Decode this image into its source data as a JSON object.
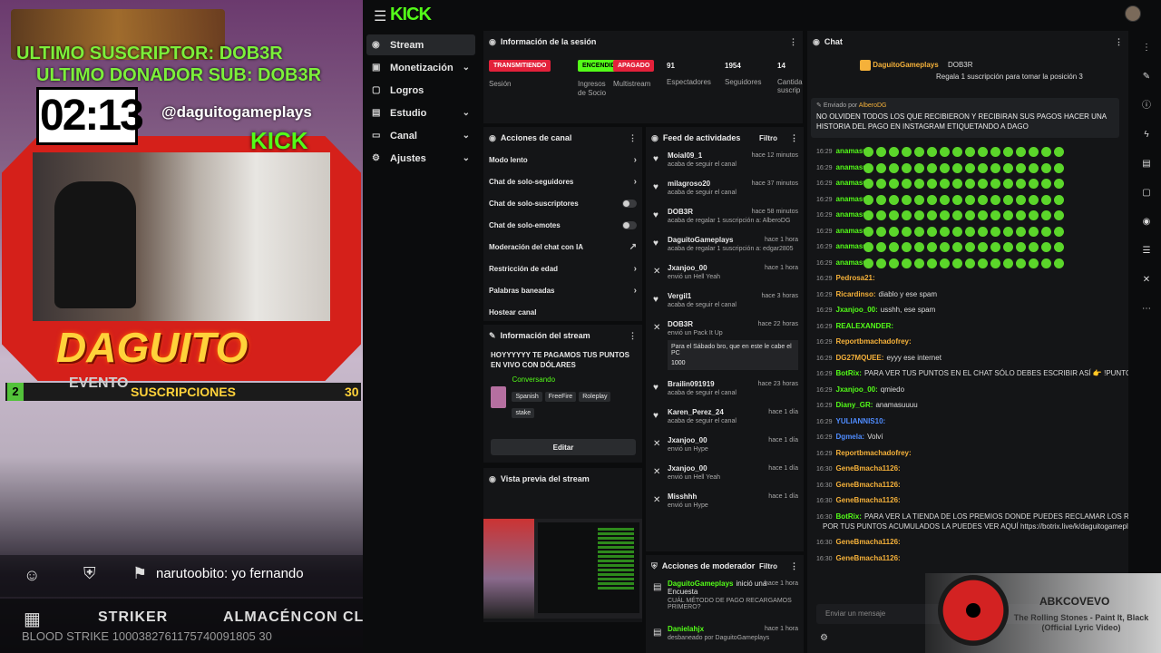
{
  "overlay": {
    "sub": "ULTIMO SUSCRIPTOR: DOB3R",
    "donor": "ULTIMO DONADOR SUB: DOB3R",
    "timer": "02:13",
    "instagram": "@daguitogameplays",
    "kick": "KICK",
    "name": "DAGUITO",
    "evento": "EVENTO",
    "bar_num": "2",
    "bar_label": "SUSCRIPCIONES",
    "bar_count": "30",
    "chatline": "narutoobito:  yo fernando",
    "menu": [
      "STRIKER",
      "ALMACÉN",
      "CON CLA"
    ],
    "code": "BLOOD STRIKE 1000382761175740091805 30"
  },
  "top": {
    "logo": "KICK"
  },
  "sidebar": [
    {
      "label": "Stream",
      "icon": "◉",
      "active": true
    },
    {
      "label": "Monetización",
      "icon": "▣",
      "chev": "⌄"
    },
    {
      "label": "Logros",
      "icon": "▢"
    },
    {
      "label": "Estudio",
      "icon": "▤",
      "chev": "⌄"
    },
    {
      "label": "Canal",
      "icon": "▭",
      "chev": "⌄"
    },
    {
      "label": "Ajustes",
      "icon": "⚙",
      "chev": "⌄"
    }
  ],
  "session": {
    "title": "Información de la sesión",
    "badges": [
      {
        "label": "TRANSMITIENDO",
        "color": "#e3213a"
      },
      {
        "label": "ENCENDIDO",
        "color": "#53fc18"
      },
      {
        "label": "APAGADO",
        "color": "#e3213a"
      }
    ],
    "badge_labels": [
      "Sesión",
      "Ingresos de Socio",
      "Multistream"
    ],
    "stats": [
      {
        "value": "91",
        "label": "Espectadores"
      },
      {
        "value": "1954",
        "label": "Seguidores"
      },
      {
        "value": "14",
        "label": "Cantidad suscrip"
      }
    ]
  },
  "canal": {
    "title": "Acciones de canal",
    "items": [
      "Modo lento",
      "Chat de solo-seguidores",
      "Chat de solo-suscriptores",
      "Chat de solo-emotes",
      "Moderación del chat con IA",
      "Restricción de edad",
      "Palabras baneadas",
      "Hostear canal"
    ]
  },
  "info": {
    "title": "Información del stream",
    "text": "HOYYYYYY TE PAGAMOS TUS PUNTOS EN VIVO CON DÓLARES",
    "category": "Conversando",
    "tags": [
      "Spanish",
      "FreeFire",
      "Roleplay",
      "stake"
    ],
    "edit": "Editar"
  },
  "preview": {
    "title": "Vista previa del stream"
  },
  "feed": {
    "title": "Feed de actividades",
    "filter": "Filtro",
    "items": [
      {
        "icon": "♥",
        "name": "Moial09_1",
        "time": "hace 12 minutos",
        "desc": "acaba de seguir el canal"
      },
      {
        "icon": "♥",
        "name": "milagroso20",
        "time": "hace 37 minutos",
        "desc": "acaba de seguir el canal"
      },
      {
        "icon": "♥",
        "name": "DOB3R",
        "time": "hace 58 minutos",
        "desc": "acaba de regalar 1 suscripción a: AlberoDG"
      },
      {
        "icon": "♥",
        "name": "DaguitoGameplays",
        "time": "hace 1 hora",
        "desc": "acaba de regalar 1 suscripción a: edgar2805"
      },
      {
        "icon": "✕",
        "name": "Jxanjoo_00",
        "time": "hace 1 hora",
        "desc": "envió un Hell Yeah"
      },
      {
        "icon": "♥",
        "name": "Vergil1",
        "time": "hace 3 horas",
        "desc": "acaba de seguir el canal"
      },
      {
        "icon": "✕",
        "name": "DOB3R",
        "time": "hace 22 horas",
        "desc": "envió un Pack It Up"
      },
      {
        "icon": "♥",
        "name": "Brailin091919",
        "time": "hace 23 horas",
        "desc": "acaba de seguir el canal"
      },
      {
        "icon": "♥",
        "name": "Karen_Perez_24",
        "time": "hace 1 día",
        "desc": "acaba de seguir el canal"
      },
      {
        "icon": "✕",
        "name": "Jxanjoo_00",
        "time": "hace 1 día",
        "desc": "envió un Hype"
      },
      {
        "icon": "✕",
        "name": "Jxanjoo_00",
        "time": "hace 1 día",
        "desc": "envió un Hell Yeah"
      },
      {
        "icon": "✕",
        "name": "Misshhh",
        "time": "hace 1 día",
        "desc": "envió un Hype"
      }
    ],
    "note": "Para el Sábado bro, que en este le cabe el PC",
    "note_amount": "1000"
  },
  "mod": {
    "title": "Acciones de moderador",
    "filter": "Filtro",
    "items": [
      {
        "name": "DaguitoGameplays",
        "action": "inició una Encuesta",
        "time": "hace 1 hora",
        "desc": "CUÁL MÉTODO DE PAGO RECARGAMOS PRIMERO?"
      },
      {
        "name": "Danielahjx",
        "action": "",
        "time": "hace 1 hora",
        "desc": "desbaneado por DaguitoGameplays"
      }
    ]
  },
  "chat": {
    "title": "Chat",
    "gift_user": "DaguitoGameplays",
    "gift_to": "DOB3R",
    "gift_text": "Regala 1 suscripción para tomar la posición 3",
    "pinned_by": "Enviado por",
    "pinned_user": "AlberoDG",
    "pinned_text": "NO OLVIDEN TODOS LOS QUE RECIBIERON Y RECIBIRAN SUS PAGOS HACER UNA HISTORIA DEL PAGO EN INSTAGRAM ETIQUETANDO A DAGO",
    "emote_lines": [
      {
        "t": "16:29",
        "u": "anamasu:"
      },
      {
        "t": "16:29",
        "u": "anamasu:"
      },
      {
        "t": "16:29",
        "u": "anamasu:"
      },
      {
        "t": "16:29",
        "u": "anamasu:"
      },
      {
        "t": "16:29",
        "u": "anamasu:"
      },
      {
        "t": "16:29",
        "u": "anamasu:"
      },
      {
        "t": "16:29",
        "u": "anamasu:"
      },
      {
        "t": "16:29",
        "u": "anamasu:"
      }
    ],
    "lines": [
      {
        "t": "16:29",
        "u": "Pedrosa21:",
        "m": "",
        "c": "#f5b13a"
      },
      {
        "t": "16:29",
        "u": "Ricardinso:",
        "m": "diablo y ese spam",
        "c": "#f5b13a"
      },
      {
        "t": "16:29",
        "u": "Jxanjoo_00:",
        "m": "usshh, ese spam",
        "c": "#53fc18"
      },
      {
        "t": "16:29",
        "u": "REALEXANDER:",
        "m": "",
        "c": "#53fc18"
      },
      {
        "t": "16:29",
        "u": "Reportbmachadofrey:",
        "m": "",
        "c": "#f5b13a"
      },
      {
        "t": "16:29",
        "u": "DG27MQUEE:",
        "m": "eyyy ese internet",
        "c": "#f5b13a"
      },
      {
        "t": "16:29",
        "u": "BotRix:",
        "m": "PARA VER TUS PUNTOS EN EL CHAT SÓLO DEBES ESCRIBIR ASÍ 👉 !PUNTOS",
        "c": "#53fc18"
      },
      {
        "t": "16:29",
        "u": "Jxanjoo_00:",
        "m": "qmiedo",
        "c": "#53fc18"
      },
      {
        "t": "16:29",
        "u": "Diany_GR:",
        "m": "anamasuuuu",
        "c": "#53fc18"
      },
      {
        "t": "16:29",
        "u": "YULIANNIS10:",
        "m": "",
        "c": "#4f8cff"
      },
      {
        "t": "16:29",
        "u": "Dgmela:",
        "m": "Volví",
        "c": "#4f8cff"
      },
      {
        "t": "16:29",
        "u": "Reportbmachadofrey:",
        "m": "",
        "c": "#f5b13a"
      },
      {
        "t": "16:30",
        "u": "GeneBmacha1126:",
        "m": "",
        "c": "#f5b13a"
      },
      {
        "t": "16:30",
        "u": "GeneBmacha1126:",
        "m": "",
        "c": "#f5b13a"
      },
      {
        "t": "16:30",
        "u": "GeneBmacha1126:",
        "m": "",
        "c": "#f5b13a"
      },
      {
        "t": "16:30",
        "u": "BotRix:",
        "m": "PARA VER LA TIENDA DE LOS PREMIOS DONDE PUEDES RECLAMAR LOS REGALOS",
        "c": "#53fc18"
      },
      {
        "t": "",
        "u": "",
        "m": "POR TUS PUNTOS ACUMULADOS LA PUEDES VER AQUÍ https://botrix.live/k/daguitogameplays/shop",
        "c": "#53fc18"
      },
      {
        "t": "16:30",
        "u": "GeneBmacha1126:",
        "m": "",
        "c": "#f5b13a"
      },
      {
        "t": "16:30",
        "u": "GeneBmacha1126:",
        "m": "",
        "c": "#f5b13a"
      }
    ],
    "input_placeholder": "Enviar un mensaje"
  },
  "music": {
    "artist": "ABKCOVEVO",
    "track": "The Rolling Stones - Paint It, Black",
    "sub": "(Official Lyric Video)"
  }
}
